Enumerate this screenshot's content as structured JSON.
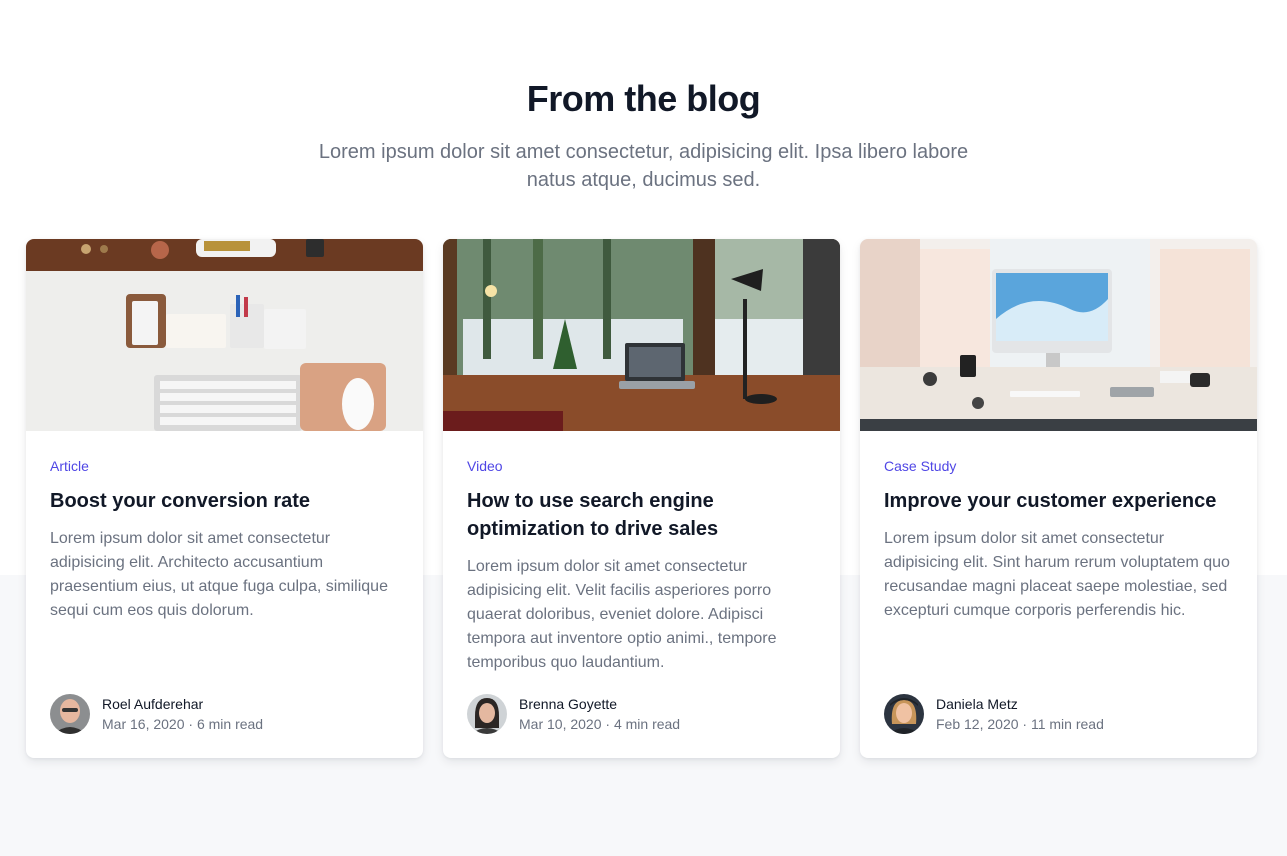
{
  "header": {
    "title": "From the blog",
    "subtitle": "Lorem ipsum dolor sit amet consectetur, adipisicing elit. Ipsa libero labore natus atque, ducimus sed."
  },
  "posts": [
    {
      "category": "Article",
      "title": "Boost your conversion rate",
      "excerpt": "Lorem ipsum dolor sit amet consectetur adipisicing elit. Architecto accusantium praesentium eius, ut atque fuga culpa, similique sequi cum eos quis dolorum.",
      "author": "Roel Aufderehar",
      "date": "Mar 16, 2020",
      "read_time": "6 min read"
    },
    {
      "category": "Video",
      "title": "How to use search engine optimization to drive sales",
      "excerpt": "Lorem ipsum dolor sit amet consectetur adipisicing elit. Velit facilis asperiores porro quaerat doloribus, eveniet dolore. Adipisci tempora aut inventore optio animi., tempore temporibus quo laudantium.",
      "author": "Brenna Goyette",
      "date": "Mar 10, 2020",
      "read_time": "4 min read"
    },
    {
      "category": "Case Study",
      "title": "Improve your customer experience",
      "excerpt": "Lorem ipsum dolor sit amet consectetur adipisicing elit. Sint harum rerum voluptatem quo recusandae magni placeat saepe molestiae, sed excepturi cumque corporis perferendis hic.",
      "author": "Daniela Metz",
      "date": "Feb 12, 2020",
      "read_time": "11 min read"
    }
  ],
  "separator": "·",
  "colors": {
    "accent": "#4f46e5",
    "muted": "#6b7280",
    "heading": "#111827",
    "page_bg_bottom": "#f7f8fa"
  }
}
